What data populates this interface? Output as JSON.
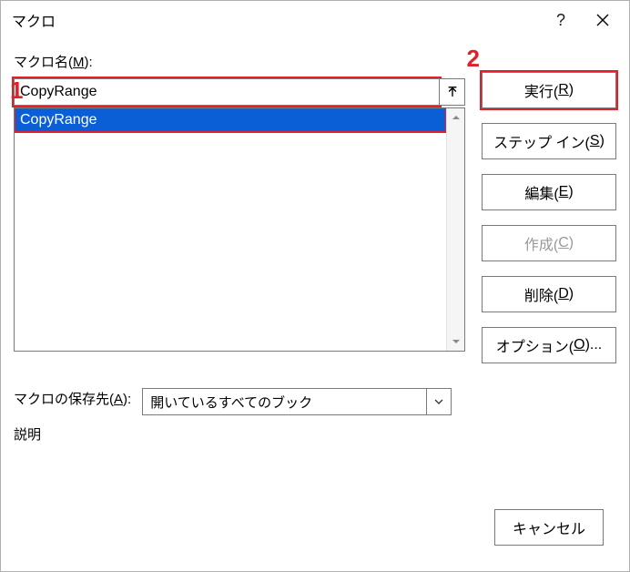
{
  "titlebar": {
    "title": "マクロ",
    "help_icon": "?",
    "close_icon": "×"
  },
  "labels": {
    "macro_name_prefix": "マクロ名(",
    "macro_name_key": "M",
    "macro_name_suffix": "):",
    "storage_prefix": "マクロの保存先(",
    "storage_key": "A",
    "storage_suffix": "):",
    "description": "説明"
  },
  "macro": {
    "name_value": "CopyRange",
    "list": [
      {
        "label": "CopyRange",
        "selected": true
      }
    ],
    "storage_value": "開いているすべてのブック"
  },
  "buttons": {
    "run_prefix": "実行(",
    "run_key": "R",
    "run_suffix": ")",
    "stepin_prefix": "ステップ イン(",
    "stepin_key": "S",
    "stepin_suffix": ")",
    "edit_prefix": "編集(",
    "edit_key": "E",
    "edit_suffix": ")",
    "create_prefix": "作成(",
    "create_key": "C",
    "create_suffix": ")",
    "delete_prefix": "削除(",
    "delete_key": "D",
    "delete_suffix": ")",
    "options_prefix": "オプション(",
    "options_key": "O",
    "options_suffix": ")...",
    "cancel": "キャンセル"
  },
  "callouts": {
    "one": "1",
    "two": "2"
  }
}
